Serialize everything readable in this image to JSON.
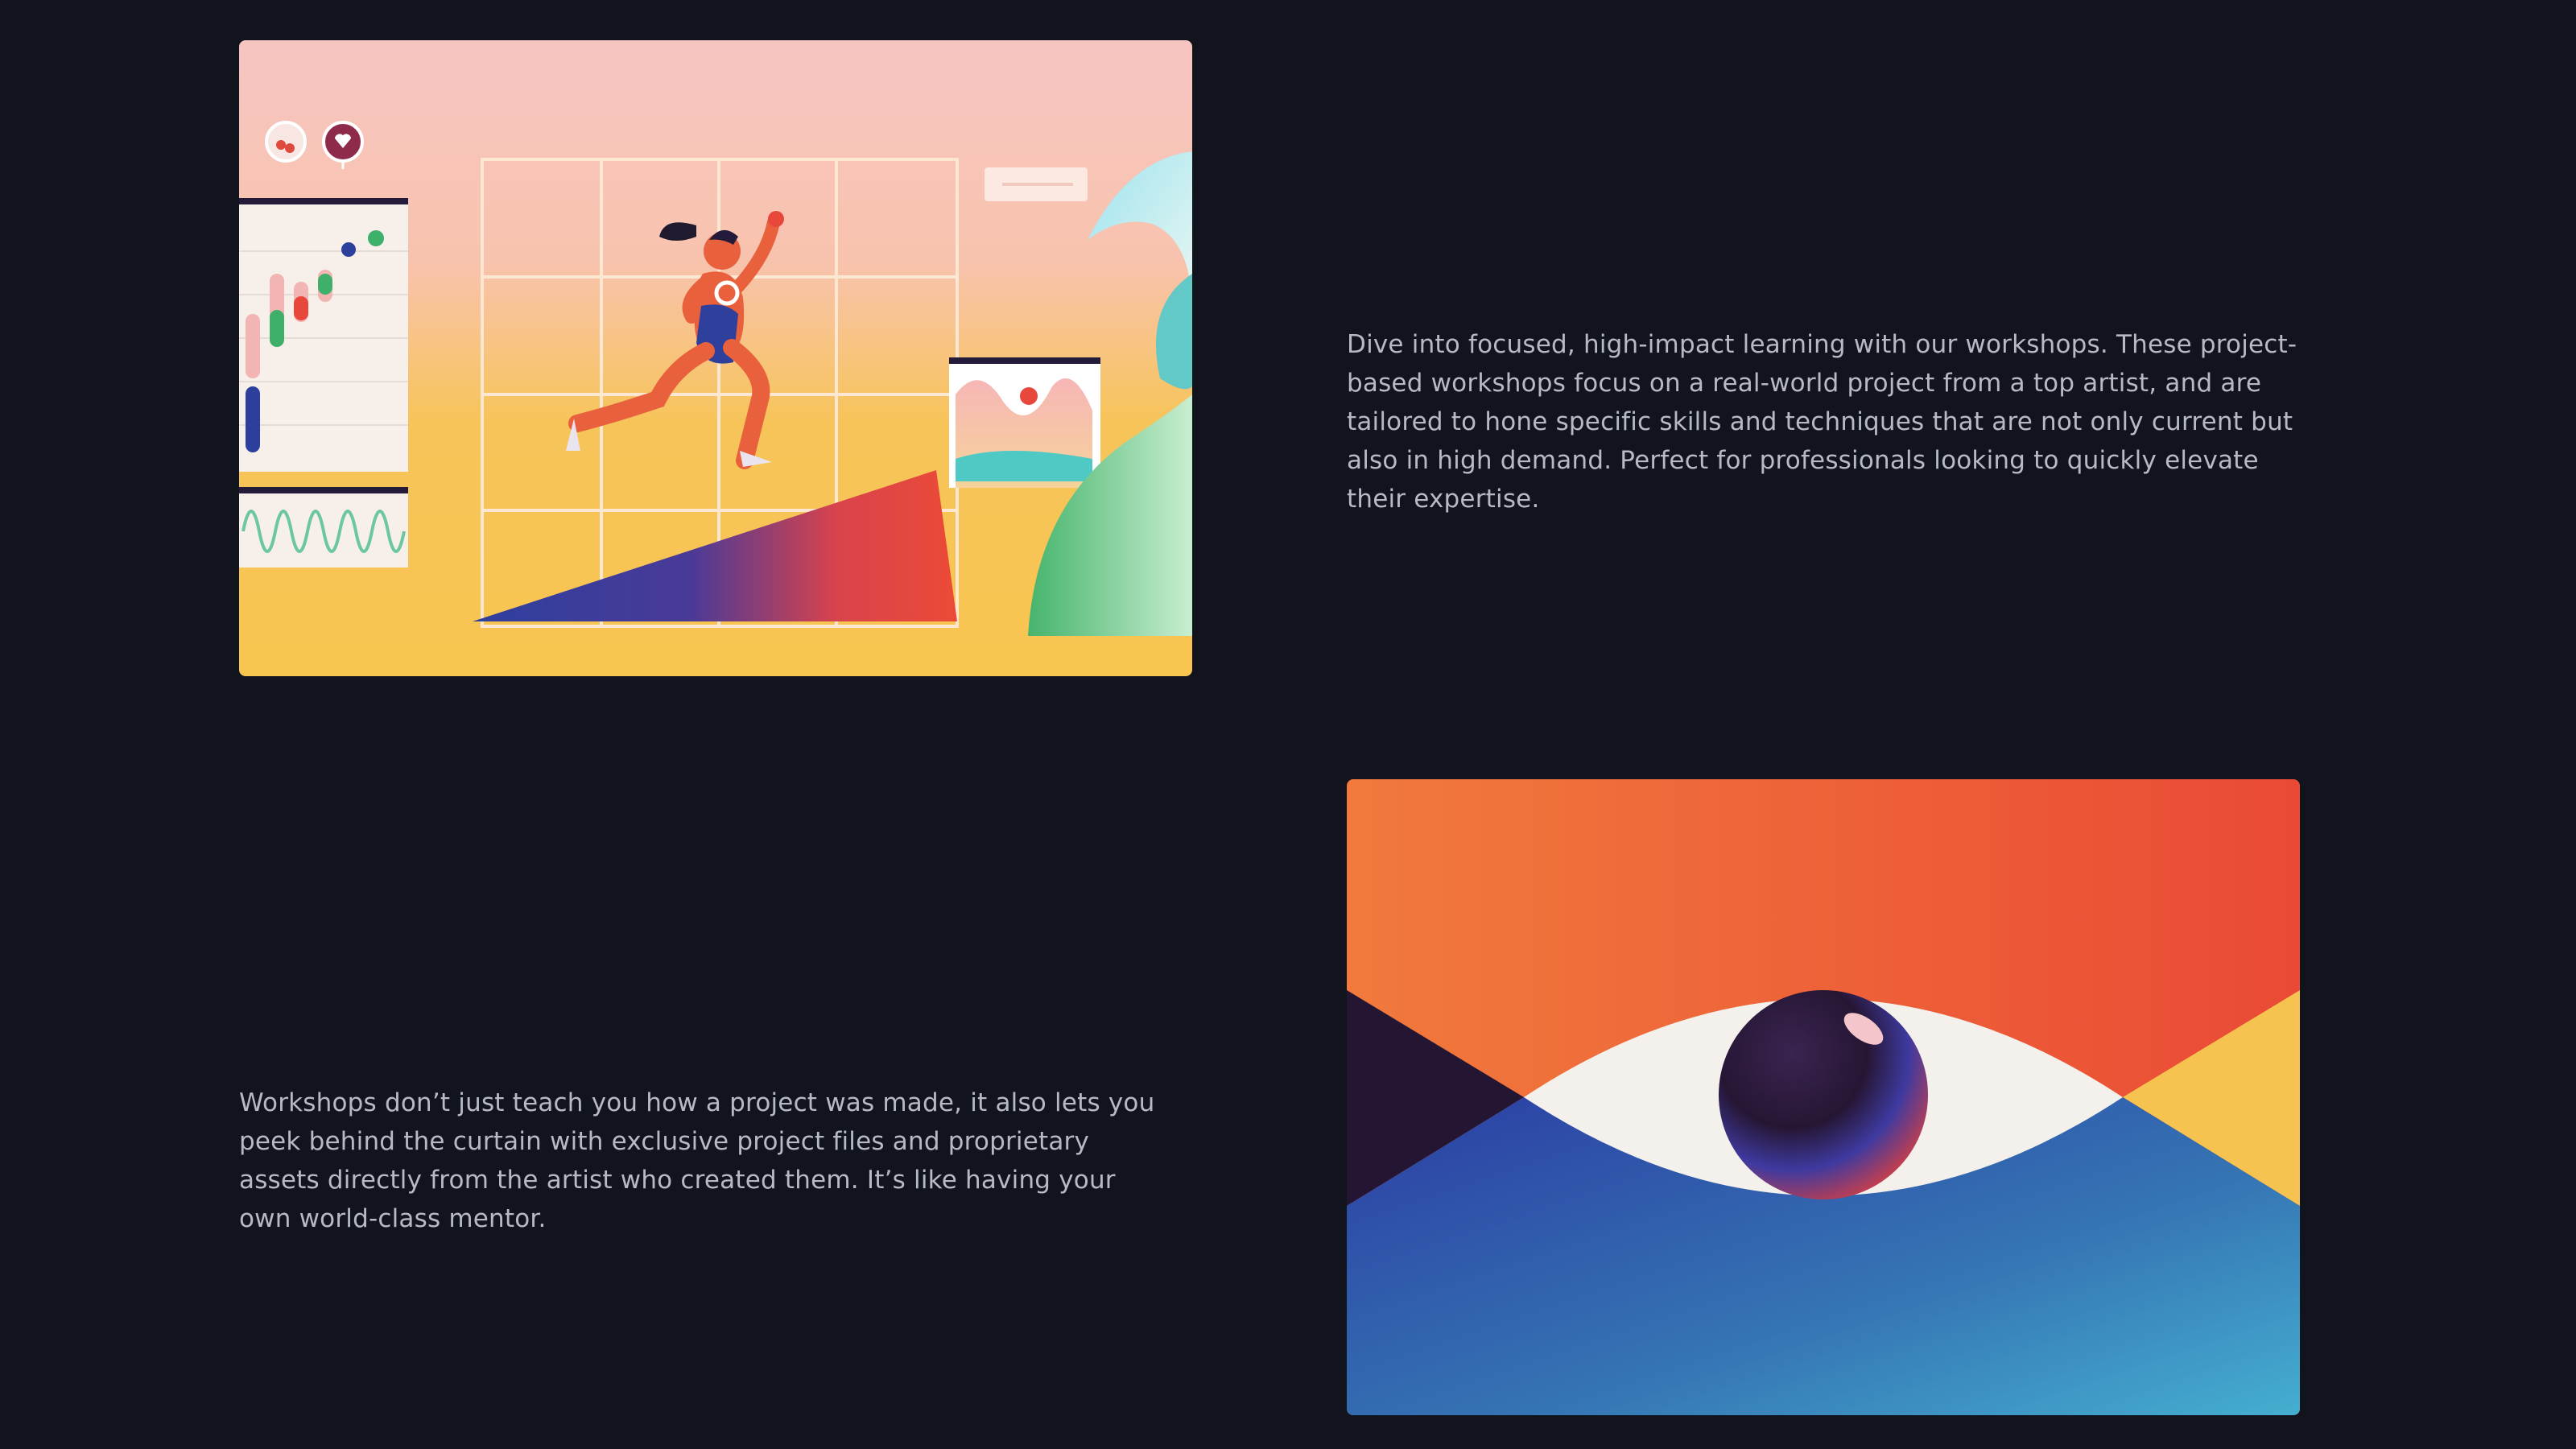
{
  "sections": [
    {
      "illustration": {
        "subject": "runner-on-growth-chart-illustration",
        "colors": {
          "pink": "#f6c7c1",
          "yellow": "#f7c350",
          "red": "#e8483b",
          "blue": "#2f3f9a",
          "green": "#4ab872"
        }
      },
      "paragraph": "Dive into focused, high-impact learning with our workshops. These project-based workshops focus on a real-world project from a top artist, and are tailored to hone specific skills and techniques that are not only current but also in high demand. Perfect for professionals looking to quickly elevate their expertise."
    },
    {
      "illustration": {
        "subject": "eye-illustration",
        "colors": {
          "orange": "#f0763c",
          "red": "#e8483b",
          "blue": "#2f45a5",
          "teal": "#44a7cb",
          "yellow": "#f7c350",
          "dark": "#241632"
        }
      },
      "paragraph": "Workshops don’t just teach you how a project was made, it also lets you peek behind the curtain with exclusive project files and proprietary assets directly from the artist who created them. It’s like having your own world-class mentor."
    }
  ]
}
